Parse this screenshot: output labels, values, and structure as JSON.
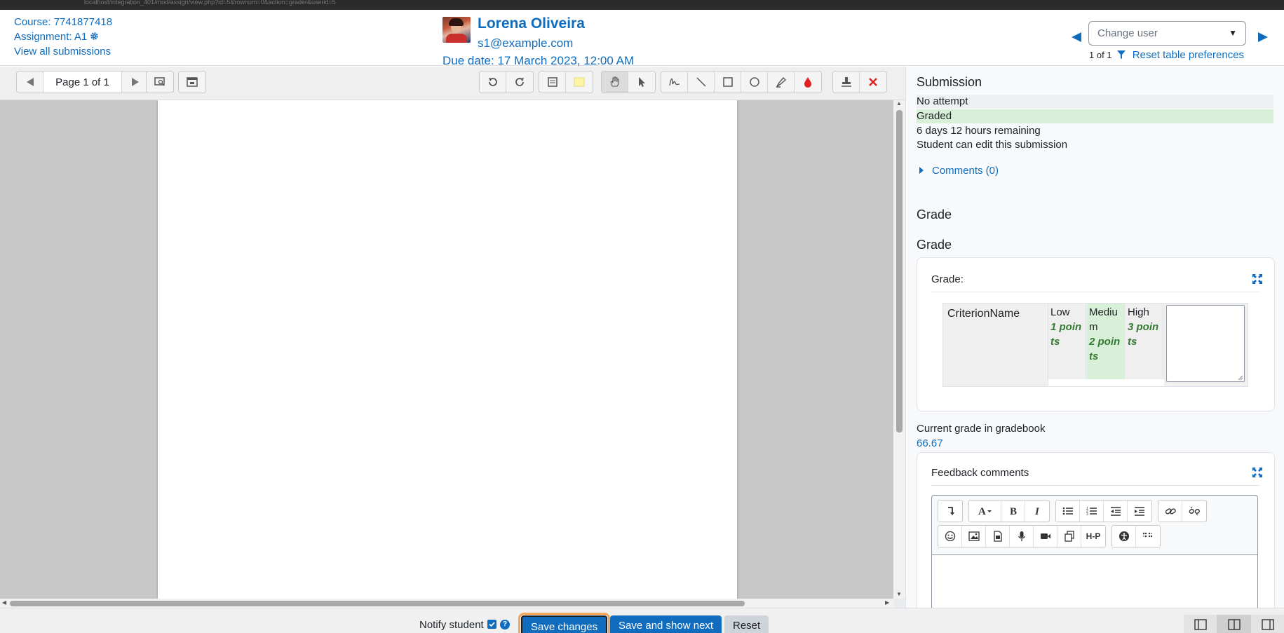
{
  "browser": {
    "url": "localhost/integration_401/mod/assign/view.php?id=5&rownum=0&action=grader&userid=5"
  },
  "header": {
    "course_link": "Course: 7741877418",
    "assignment_link": "Assignment: A1",
    "view_all_link": "View all submissions",
    "user_name": "Lorena Oliveira",
    "user_email": "s1@example.com",
    "due_date": "Due date: 17 March 2023, 12:00 AM",
    "change_user_placeholder": "Change user",
    "pager_count": "1 of 1",
    "reset_table": "Reset table preferences"
  },
  "pdf_toolbar": {
    "page_label": "Page 1 of 1",
    "icons": [
      "previous-page-icon",
      "next-page-icon",
      "search-comments-icon",
      "expand-comments-icon",
      "rotate-left-icon",
      "rotate-right-icon",
      "comment-icon",
      "comment-colour-icon",
      "pan-icon",
      "select-icon",
      "pen-icon",
      "line-icon",
      "rectangle-icon",
      "oval-icon",
      "highlighter-icon",
      "annotation-colour-icon",
      "stamp-icon",
      "delete-icon"
    ]
  },
  "submission": {
    "heading": "Submission",
    "status_attempt": "No attempt",
    "status_grading": "Graded",
    "time_remaining": "6 days 12 hours remaining",
    "edit_status": "Student can edit this submission",
    "comments_link": "Comments (0)"
  },
  "grade": {
    "heading1": "Grade",
    "heading2": "Grade",
    "card_title": "Grade:",
    "criterion": "CriterionName",
    "levels": [
      {
        "name": "Low",
        "points": "1 points",
        "selected": false
      },
      {
        "name": "Medium",
        "points": "2 points",
        "selected": true
      },
      {
        "name": "High",
        "points": "3 points",
        "selected": false
      }
    ],
    "gradebook_label": "Current grade in gradebook",
    "gradebook_value": "66.67"
  },
  "feedback": {
    "card_title": "Feedback comments"
  },
  "footer": {
    "notify_label": "Notify student",
    "notify_checked": true,
    "save_label": "Save changes",
    "save_next_label": "Save and show next",
    "reset_label": "Reset"
  },
  "colors": {
    "brand": "#0f6cbf",
    "graded_bg": "#d7f0d7",
    "focus_outline": "#f5a55a"
  }
}
